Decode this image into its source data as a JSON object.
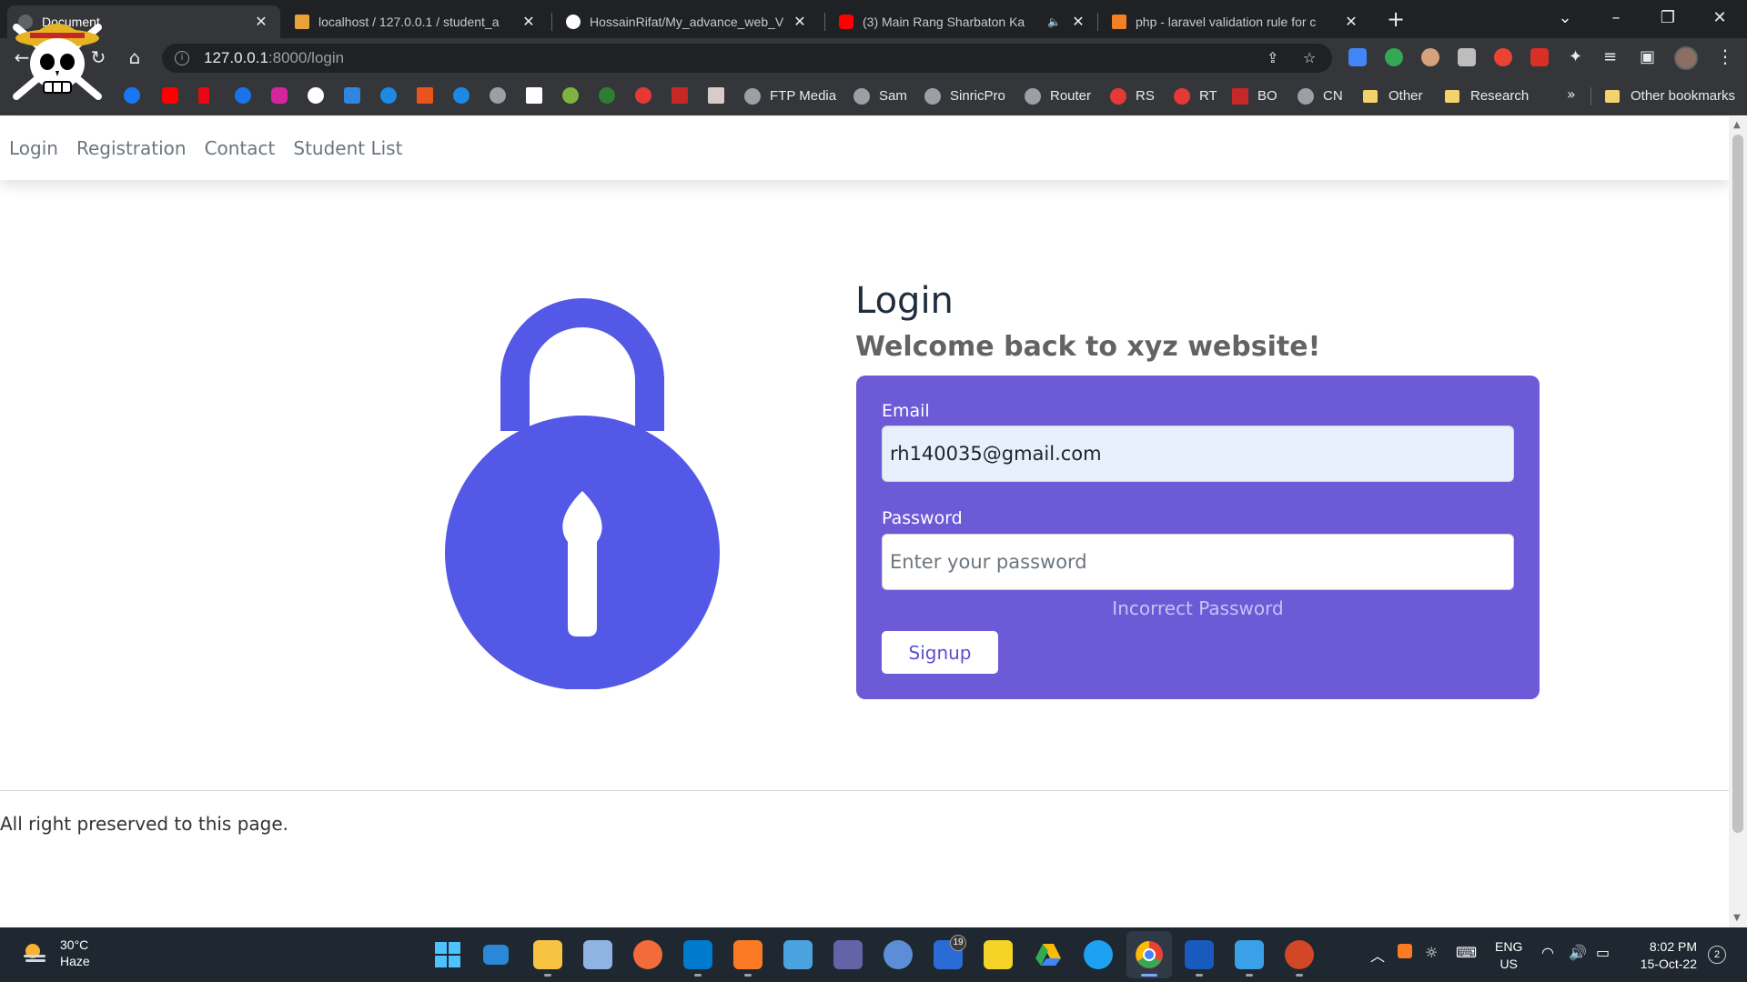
{
  "browser": {
    "tabs": [
      {
        "label": "Document",
        "active": true
      },
      {
        "label": "localhost / 127.0.0.1 / student_a"
      },
      {
        "label": "HossainRifat/My_advance_web_V"
      },
      {
        "label": "(3) Main Rang Sharbaton Ka"
      },
      {
        "label": "php - laravel validation rule for c"
      }
    ],
    "url_host": "127.0.0.1",
    "url_rest": ":8000/login",
    "bookmarks": [
      {
        "label": "FTP Media"
      },
      {
        "label": "Sam"
      },
      {
        "label": "SinricPro"
      },
      {
        "label": "Router"
      },
      {
        "label": "RS"
      },
      {
        "label": "RT"
      },
      {
        "label": "BO"
      },
      {
        "label": "CN"
      },
      {
        "label": "Other"
      },
      {
        "label": "Research"
      }
    ],
    "other_bookmarks": "Other bookmarks",
    "more_label": "»"
  },
  "site": {
    "nav": [
      "Login",
      "Registration",
      "Contact",
      "Student List"
    ],
    "title": "Login",
    "subtitle": "Welcome back to xyz website!",
    "form": {
      "email_label": "Email",
      "email_value": "rh140035@gmail.com",
      "password_label": "Password",
      "password_placeholder": "Enter your password",
      "error": "Incorrect Password",
      "submit": "Signup"
    },
    "footer": "All right preserved to this page."
  },
  "colors": {
    "lock": "#5359e6",
    "card": "#6c5ad6"
  },
  "taskbar": {
    "temperature": "30°C",
    "condition": "Haze",
    "store_badge": "19",
    "lang_top": "ENG",
    "lang_bottom": "US",
    "time": "8:02 PM",
    "date": "15-Oct-22",
    "notifications": "2"
  }
}
